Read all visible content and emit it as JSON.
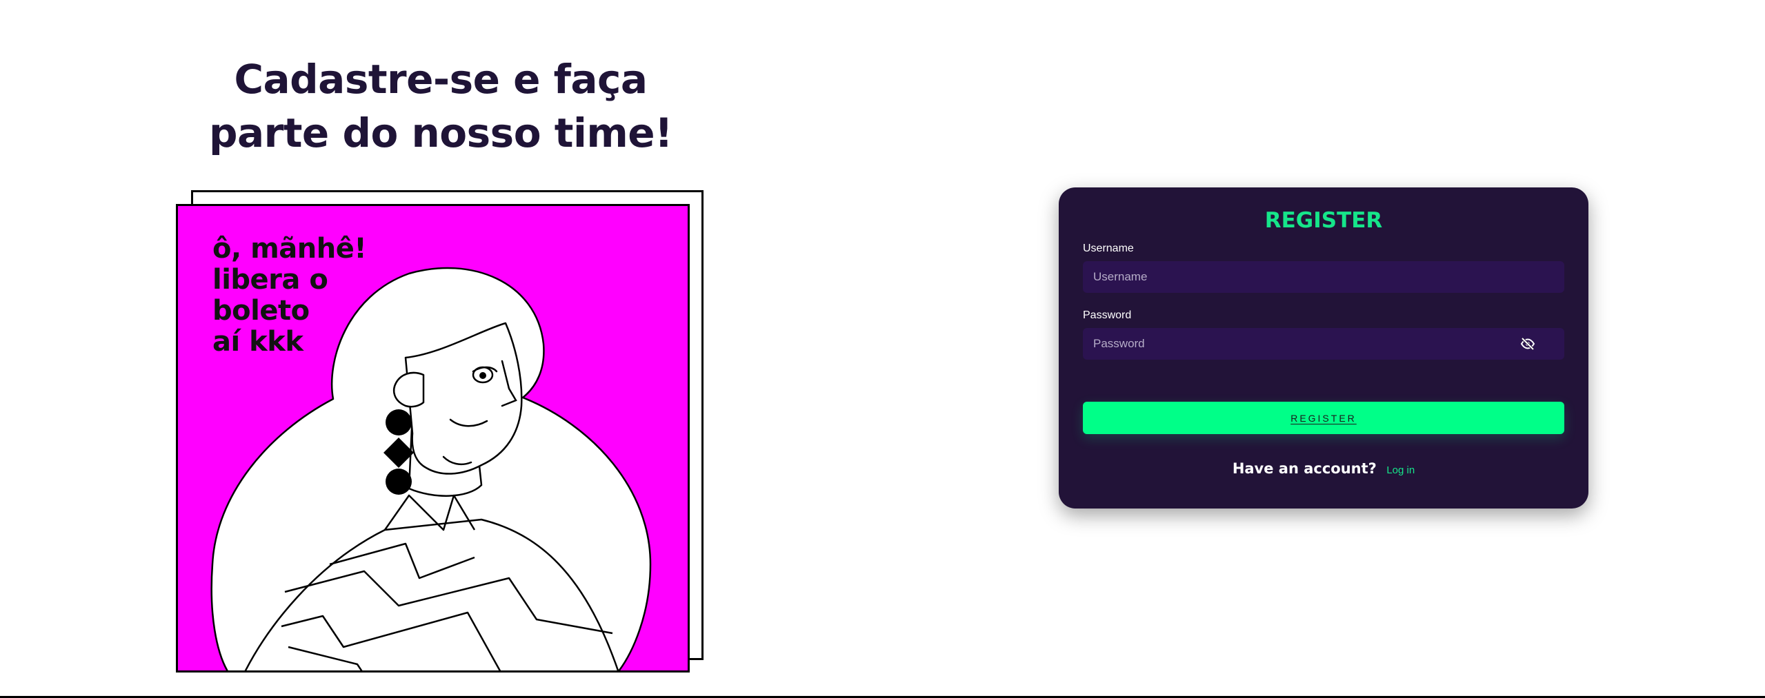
{
  "hero": {
    "headline_line1": "Cadastre-se e faça",
    "headline_line2": "parte do nosso time!"
  },
  "illustration": {
    "quote_line1": "ô, mãnhê!",
    "quote_line2": "libera o",
    "quote_line3": "boleto",
    "quote_line4": "aí kkk",
    "background_color": "#ff00ff"
  },
  "register_form": {
    "title": "REGISTER",
    "username_label": "Username",
    "username_placeholder": "Username",
    "username_value": "",
    "password_label": "Password",
    "password_placeholder": "Password",
    "password_value": "",
    "password_toggle_icon": "eye-slash-icon",
    "submit_label": "REGISTER",
    "have_account_text": "Have an account?",
    "login_link_label": "Log in"
  },
  "colors": {
    "card_background": "#221338",
    "input_background": "#2b1350",
    "accent_green": "#00ff88",
    "title_green": "#16e58a",
    "headline": "#1f1437"
  }
}
